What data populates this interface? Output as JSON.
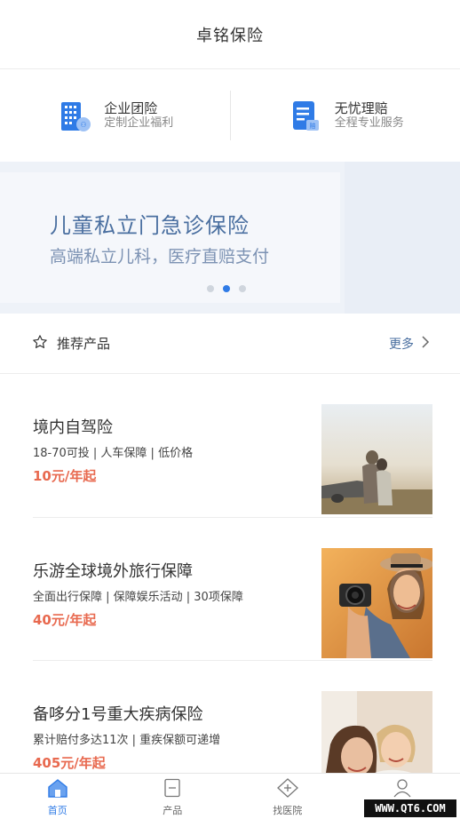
{
  "header": {
    "title": "卓铭保险"
  },
  "services": [
    {
      "title": "企业团险",
      "subtitle": "定制企业福利",
      "icon": "building-icon"
    },
    {
      "title": "无忧理赔",
      "subtitle": "全程专业服务",
      "icon": "claim-document-icon"
    }
  ],
  "banner": {
    "title": "儿童私立门急诊保险",
    "subtitle": "高端私立儿科，医疗直赔支付",
    "dots": 3,
    "active_dot": 1
  },
  "recommend": {
    "title": "推荐产品",
    "more": "更多"
  },
  "products": [
    {
      "title": "境内自驾险",
      "tags": "18-70可投 | 人车保障 | 低价格",
      "price": "10元/年起"
    },
    {
      "title": "乐游全球境外旅行保障",
      "tags": "全面出行保障 | 保障娱乐活动 | 30项保障",
      "price": "40元/年起"
    },
    {
      "title": "备哆分1号重大疾病保险",
      "tags": "累计赔付多达11次 | 重疾保额可递增",
      "price": "405元/年起"
    }
  ],
  "tabbar": [
    {
      "label": "首页",
      "icon": "home-icon",
      "active": true
    },
    {
      "label": "产品",
      "icon": "document-icon",
      "active": false
    },
    {
      "label": "找医院",
      "icon": "hospital-icon",
      "active": false
    },
    {
      "label": "",
      "icon": "user-icon",
      "active": false
    }
  ],
  "watermark": "WWW.QT6.COM",
  "colors": {
    "accent": "#2f7be6",
    "price": "#e8694f",
    "banner_text": "#4a6fa0"
  }
}
